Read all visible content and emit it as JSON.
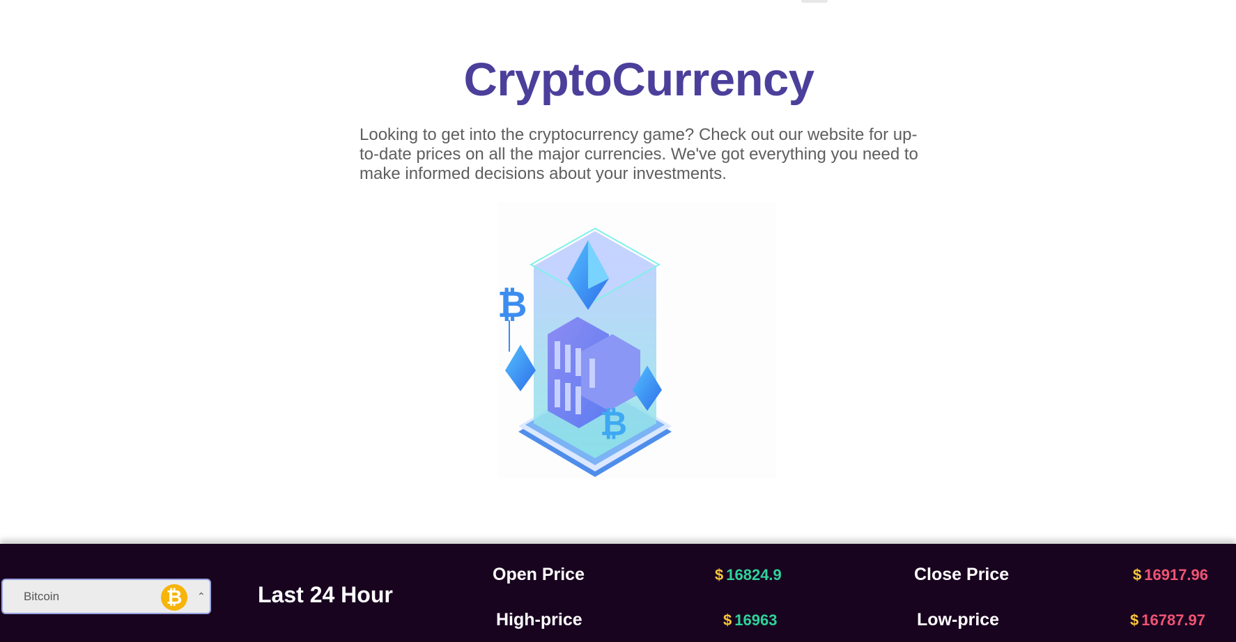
{
  "hero": {
    "title": "CryptoCurrency",
    "description": "Looking to get into the cryptocurrency game? Check out our website for up-to-date prices on all the major currencies. We've got everything you need to make informed decisions about your investments."
  },
  "illustration": {
    "icon": "crypto-tower-illustration"
  },
  "ticker": {
    "selected_coin": "Bitcoin",
    "coin_icon": "bitcoin-icon",
    "coin_symbol": "₿",
    "chevron": "⌃",
    "period": "Last 24 Hour",
    "currency_symbol": "$",
    "open_label": "Open Price",
    "open_value": "16824.9",
    "close_label": "Close Price",
    "close_value": "16917.96",
    "high_label": "High-price",
    "high_value": "16963",
    "low_label": "Low-price",
    "low_value": "16787.97",
    "colors": {
      "bar_bg": "#190420",
      "positive": "#2ed39a",
      "negative": "#f05473",
      "currency": "#f6c53a"
    }
  }
}
